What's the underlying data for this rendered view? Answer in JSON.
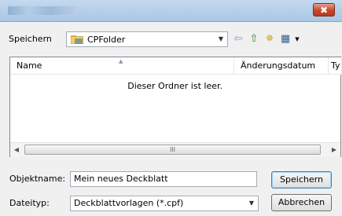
{
  "titlebar": {
    "title": "",
    "close_glyph": "✖"
  },
  "location": {
    "label": "Speichern",
    "folder": "CPFolder"
  },
  "toolbar": {
    "back_icon": "⇦",
    "up_icon": "⇧",
    "new_folder_icon": "✵",
    "view_icon": "▦"
  },
  "list": {
    "columns": [
      {
        "label": "Name"
      },
      {
        "label": "Änderungsdatum"
      },
      {
        "label": "Ty"
      }
    ],
    "empty_message": "Dieser Ordner ist leer."
  },
  "scrollbar": {
    "left": "◀",
    "right": "▶",
    "grip": "III"
  },
  "filename": {
    "label": "Objektname:",
    "value": "Mein neues Deckblatt"
  },
  "filetype": {
    "label": "Dateityp:",
    "value": "Deckblattvorlagen (*.cpf)"
  },
  "buttons": {
    "save": "Speichern",
    "cancel": "Abbrechen"
  }
}
